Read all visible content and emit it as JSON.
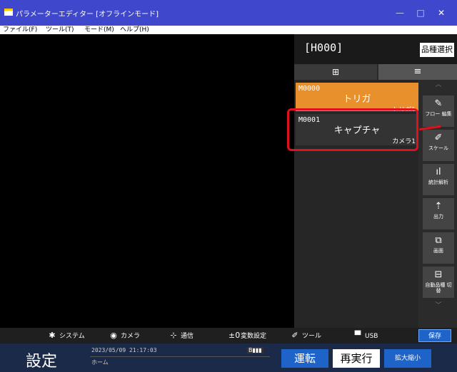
{
  "window": {
    "title": "パラメーターエディター [オフラインモード]",
    "minimize": "—",
    "maximize": "□",
    "close": "✕"
  },
  "menu": [
    "ファイル(F)",
    "ツール(T)",
    "モード(M)",
    "ヘルプ(H)"
  ],
  "panel": {
    "project": "[H000]",
    "select_button": "品種選択",
    "grid_icon": "grid-icon",
    "list_icon": "list-icon",
    "grid_glyph": "⊞",
    "list_glyph": "≡",
    "units": [
      {
        "id": "M0000",
        "name": "トリガ",
        "camera": "トリガ1"
      },
      {
        "id": "M0001",
        "name": "キャプチャ",
        "camera": "カメラ1"
      }
    ],
    "tools": [
      {
        "icon": "pencil-icon",
        "glyph": "✎",
        "label": "フロー 編集"
      },
      {
        "icon": "ruler-icon",
        "glyph": "✐",
        "label": "スケール"
      },
      {
        "icon": "bar-chart-icon",
        "glyph": "ıl",
        "label": "統計解析"
      },
      {
        "icon": "output-icon",
        "glyph": "⇡",
        "label": "出力"
      },
      {
        "icon": "screen-icon",
        "glyph": "⧉",
        "label": "画面"
      },
      {
        "icon": "auto-switch-icon",
        "glyph": "⊟",
        "label": "自動品種 切替"
      }
    ],
    "scroll_up": "︿",
    "scroll_down": "﹀"
  },
  "bottombar": {
    "items": [
      {
        "icon": "gear-icon",
        "glyph": "✱",
        "label": "システム"
      },
      {
        "icon": "camera-icon",
        "glyph": "◉",
        "label": "カメラ"
      },
      {
        "icon": "network-icon",
        "glyph": "⊹",
        "label": "通信"
      },
      {
        "icon": "variable-icon",
        "glyph": "±0",
        "label": "変数設定"
      },
      {
        "icon": "wrench-icon",
        "glyph": "✐",
        "label": "ツール"
      },
      {
        "icon": "usb-icon",
        "glyph": "▀",
        "label": "USB"
      }
    ],
    "save": "保存"
  },
  "status": {
    "mode": "設定",
    "datetime": "2023/05/09 21:17:03",
    "location": "ホーム",
    "memory": "B▮▮▮",
    "run": "運転",
    "rerun": "再実行",
    "zoom": "拡大縮小"
  },
  "colors": {
    "titlebar": "#3f48cc",
    "accent": "#1e64c8",
    "unit_active": "#e8902b",
    "highlight": "#e0101e"
  }
}
